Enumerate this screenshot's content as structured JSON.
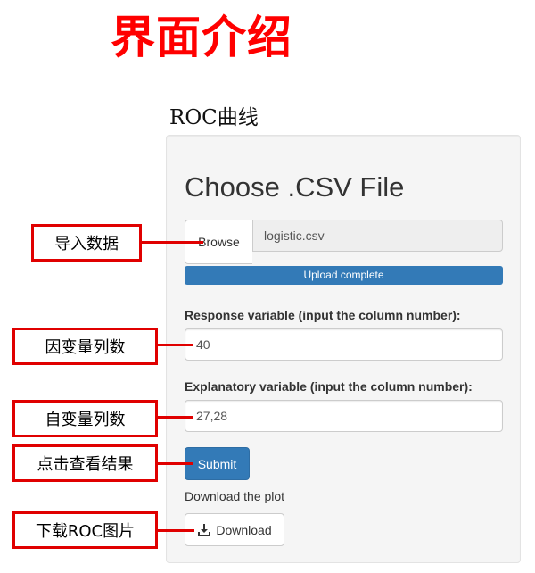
{
  "page": {
    "main_title": "界面介绍",
    "section_title": "ROC曲线"
  },
  "panel": {
    "heading": "Choose .CSV File",
    "browse_label": "Browse",
    "file_name": "logistic.csv",
    "upload_status": "Upload complete",
    "upload_progress_percent": 100,
    "response_label": "Response variable (input the column number):",
    "response_value": "40",
    "explanatory_label": "Explanatory variable (input the column number):",
    "explanatory_value": "27,28",
    "submit_label": "Submit",
    "plot_label": "Download the plot",
    "download_label": "Download",
    "download_icon": "download-icon"
  },
  "annotations": {
    "import_data": "导入数据",
    "response_columns": "因变量列数",
    "explanatory_columns": "自变量列数",
    "view_results": "点击查看结果",
    "download_roc": "下载ROC图片"
  },
  "colors": {
    "title_red": "#ff0000",
    "annotation_red": "#e00000",
    "primary_blue": "#337ab7",
    "panel_bg": "#f5f5f5"
  }
}
